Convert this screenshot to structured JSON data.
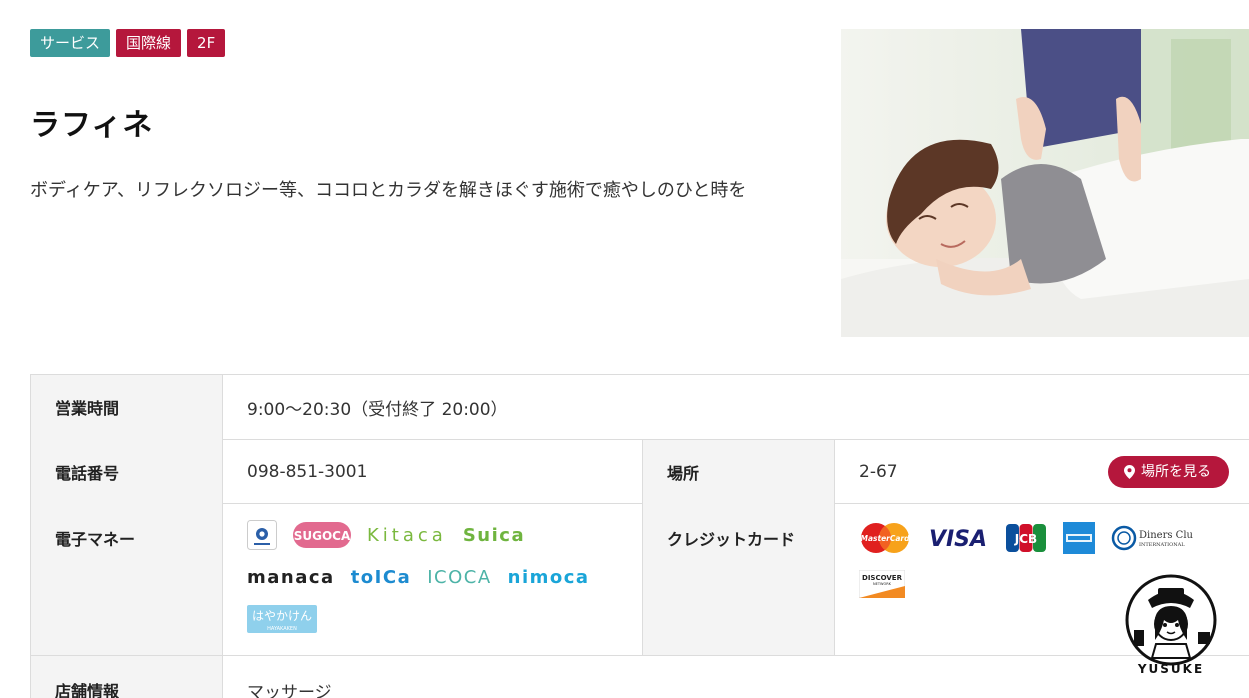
{
  "tags": {
    "category": "サービス",
    "line": "国際線",
    "floor": "2F"
  },
  "shop": {
    "name": "ラフィネ",
    "description": "ボディケア、リフレクソロジー等、ココロとカラダを解きほぐす施術で癒やしのひと時を"
  },
  "info": {
    "hours_label": "営業時間",
    "hours_value": "9:00〜20:30（受付終了 20:00）",
    "phone_label": "電話番号",
    "phone_value": "098-851-3001",
    "place_label": "場所",
    "place_value": "2-67",
    "map_button": "場所を見る",
    "emoney_label": "電子マネー",
    "credit_label": "クレジットカード",
    "shop_info_label": "店舗情報",
    "shop_info_value": "マッサージ"
  },
  "emoney": {
    "sugoca": "SUGOCA",
    "kitaca": "Kitaca",
    "suica": "Suica",
    "manaca": "manaca",
    "toica": "toICa",
    "icoca": "ICOCA",
    "nimoca": "nimoca",
    "hayakaken": "はやかけん",
    "hayakaken_sub": "HAYAKAKEN"
  },
  "cards": {
    "mastercard": "MasterCard",
    "visa": "VISA",
    "jcb": "JCB",
    "diners": "Diners Club",
    "diners_sub": "INTERNATIONAL",
    "discover": "DISCOVER",
    "discover_sub": "NETWORK"
  },
  "avatar": {
    "name": "YUSUKE"
  },
  "colors": {
    "accent": "#b5173c",
    "service_tag": "#3d9b9b",
    "th_bg": "#f4f4f4",
    "border": "#dcdcdc"
  }
}
